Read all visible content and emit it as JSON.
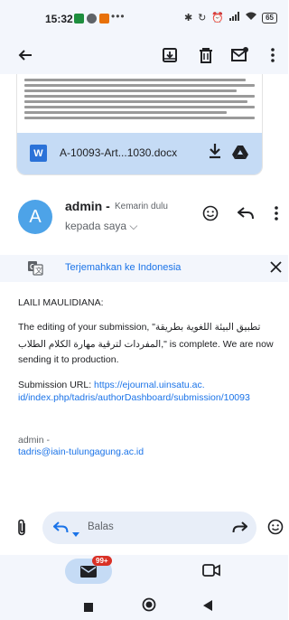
{
  "status_bar": {
    "time": "15:32",
    "more_dots": "•••",
    "battery": "65"
  },
  "app_bar": {
    "icons": [
      "back-arrow-icon",
      "archive-icon",
      "delete-icon",
      "mark-unread-icon",
      "more-vert-icon"
    ]
  },
  "attachment": {
    "file_name": "A-10093-Art...1030.docx",
    "file_type_letter": "W"
  },
  "message": {
    "sender": "admin",
    "sender_separator": "-",
    "time": "Kemarin dulu",
    "recipient": "kepada saya"
  },
  "translate": {
    "label": "Terjemahkan ke Indonesia"
  },
  "body": {
    "greeting": "LAILI MAULIDIANA:",
    "line1": "The editing of your submission, \"تطبيق البيئة اللغوية بطريقة",
    "line2": "المفردات لترقية مهارة الكلام الطلاب,\" is complete. We are now",
    "line3": "sending it to production.",
    "url_label": "Submission URL:",
    "url_part1": "https://ejournal.uinsatu.ac.",
    "url_part2": "id/index.php/tadris/authorDashboard/submission/10093",
    "signature_name": "admin -",
    "signature_email": "tadris@iain-tulungagung.ac.id"
  },
  "reply_bar": {
    "placeholder": "Balas"
  },
  "bottom_nav": {
    "mail_badge": "99+"
  },
  "colors": {
    "accent": "#1a73e8",
    "avatar": "#4da3e8",
    "surface": "#f3f6fc",
    "attachment_bar": "#c5dbf5",
    "badge": "#d93025"
  }
}
